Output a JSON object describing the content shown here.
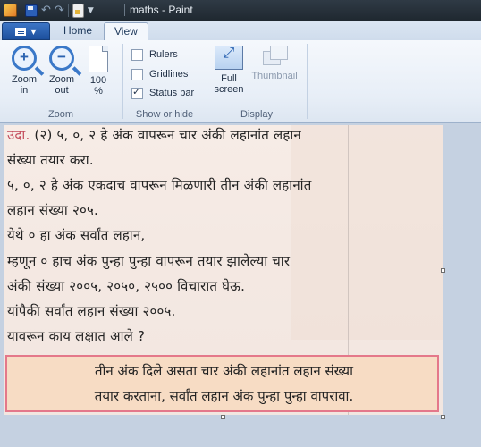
{
  "window": {
    "title": "maths - Paint"
  },
  "tabs": {
    "home": "Home",
    "view": "View"
  },
  "ribbon": {
    "zoom": {
      "zoom_in": "Zoom in",
      "zoom_out": "Zoom out",
      "hundred": "100 %",
      "label": "Zoom"
    },
    "show_hide": {
      "rulers": "Rulers",
      "gridlines": "Gridlines",
      "status_bar": "Status bar",
      "status_bar_checked": true,
      "rulers_checked": false,
      "gridlines_checked": false,
      "label": "Show or hide"
    },
    "display": {
      "full_screen": "Full screen",
      "thumbnail": "Thumbnail",
      "label": "Display"
    }
  },
  "document": {
    "line1_prefix": "उदा.",
    "line1": "(२) ५, ०, २ हे अंक वापरून चार अंकी लहानांत लहान",
    "line2": "संख्या तयार करा.",
    "line3": "५, ०, २ हे अंक एकदाच वापरून मिळणारी तीन अंकी लहानांत",
    "line4": "लहान संख्या २०५.",
    "line5": "येथे ० हा अंक सर्वांत लहान,",
    "line6": "म्हणून ० हाच अंक पुन्हा पुन्हा वापरून तयार झालेल्या चार",
    "line7": "अंकी संख्या २००५, २०५०, २५०० विचारात घेऊ.",
    "line8": "यांपैकी सर्वांत लहान संख्या २००५.",
    "line9": "यावरून काय लक्षात आले ?",
    "note1": "तीन अंक दिले असता चार अंकी लहानांत लहान संख्या",
    "note2": "तयार करताना, सर्वांत लहान अंक पुन्हा पुन्हा वापरावा."
  }
}
